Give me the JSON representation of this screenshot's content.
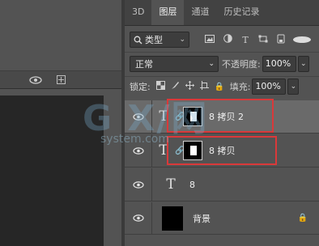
{
  "tabs": [
    {
      "label": "3D",
      "active": false
    },
    {
      "label": "图层",
      "active": true
    },
    {
      "label": "通道",
      "active": false
    },
    {
      "label": "历史记录",
      "active": false
    }
  ],
  "filter": {
    "kind_label": "类型",
    "icons": [
      "image-filter-icon",
      "adjustment-filter-icon",
      "type-filter-icon",
      "shape-filter-icon",
      "smart-object-filter-icon"
    ]
  },
  "blend": {
    "mode": "正常",
    "opacity_label": "不透明度:",
    "opacity_value": "100%"
  },
  "lock": {
    "label": "锁定:",
    "fill_label": "填充:",
    "fill_value": "100%"
  },
  "layers": [
    {
      "name": "8 拷贝 2",
      "kind": "text",
      "selected": true,
      "has_mask": true
    },
    {
      "name": "8 拷贝",
      "kind": "text",
      "selected": false,
      "has_mask": true
    },
    {
      "name": "8",
      "kind": "text",
      "selected": false,
      "has_mask": false
    },
    {
      "name": "背景",
      "kind": "background",
      "selected": false,
      "locked": true
    }
  ],
  "glyphs": {
    "type": "T",
    "link": "🔗",
    "chevron": "⌄",
    "lock": "🔒"
  },
  "watermark": {
    "main": "G X/网",
    "sub": "system.com"
  },
  "colors": {
    "panel_bg": "#535353",
    "selected_row": "#6a6a6a",
    "highlight_box": "#d9393a",
    "canvas": "#262626"
  }
}
